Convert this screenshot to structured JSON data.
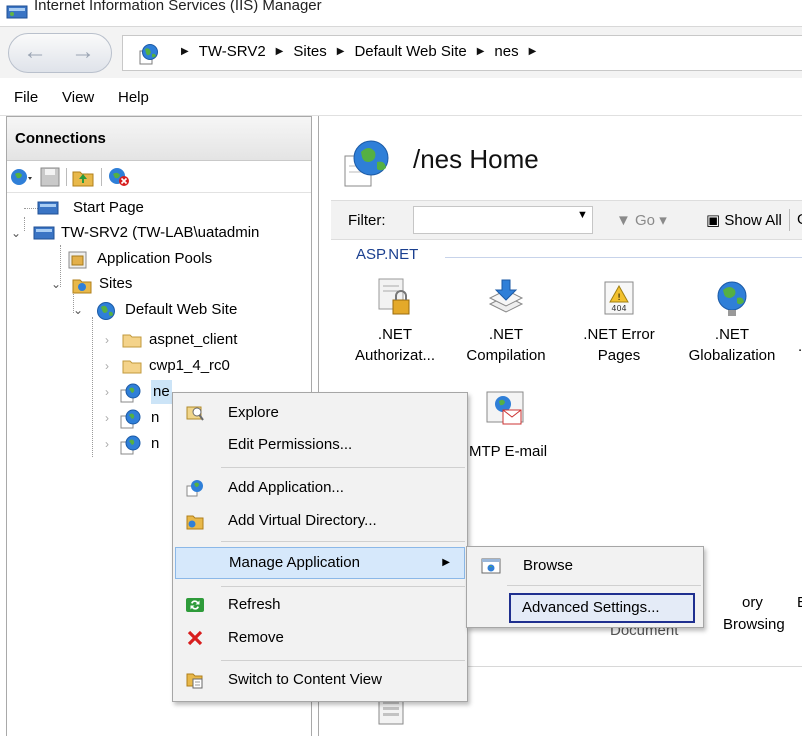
{
  "window": {
    "title": "Internet Information Services (IIS) Manager"
  },
  "address": {
    "crumbs": [
      "TW-SRV2",
      "Sites",
      "Default Web Site",
      "nes"
    ],
    "separator": "▶"
  },
  "menu": [
    "File",
    "View",
    "Help"
  ],
  "connections": {
    "header": "Connections",
    "tree": {
      "start_page": "Start Page",
      "server": "TW-SRV2 (TW-LAB\\uatadmin",
      "app_pools": "Application Pools",
      "sites": "Sites",
      "default_site": "Default Web Site",
      "aspnet_client": "aspnet_client",
      "cwp": "cwp1_4_rc0",
      "nes_truncated": "ne",
      "n2": "n",
      "n3": "n"
    }
  },
  "main": {
    "title": "/nes Home",
    "filter": {
      "label": "Filter:",
      "go": "Go",
      "show_all": "Show All",
      "group": "Gr"
    },
    "group_label": "ASP.NET",
    "features": [
      {
        "line1": ".NET",
        "line2": "Authorizat..."
      },
      {
        "line1": ".NET",
        "line2": "Compilation"
      },
      {
        "line1": ".NET Error",
        "line2": "Pages"
      },
      {
        "line1": ".NET",
        "line2": "Globalization"
      }
    ],
    "partial": {
      "smtp": "MTP E-mail",
      "directory_line1": "ory",
      "directory_line2": "Browsing",
      "default_doc": "Document",
      "e": "E",
      "dot": "."
    }
  },
  "context_menu": {
    "items": [
      {
        "label": "Explore"
      },
      {
        "label": "Edit Permissions..."
      },
      {
        "label": "Add Application..."
      },
      {
        "label": "Add Virtual Directory..."
      },
      {
        "label": "Manage Application"
      },
      {
        "label": "Refresh"
      },
      {
        "label": "Remove"
      },
      {
        "label": "Switch to Content View"
      }
    ]
  },
  "submenu": {
    "items": [
      {
        "label": "Browse"
      },
      {
        "label": "Advanced Settings..."
      }
    ]
  },
  "colors": {
    "highlight": "#d6e8fb",
    "focus_border": "#1f2f8f",
    "group_label": "#1a3f8f",
    "remove_x": "#d81e1e"
  }
}
